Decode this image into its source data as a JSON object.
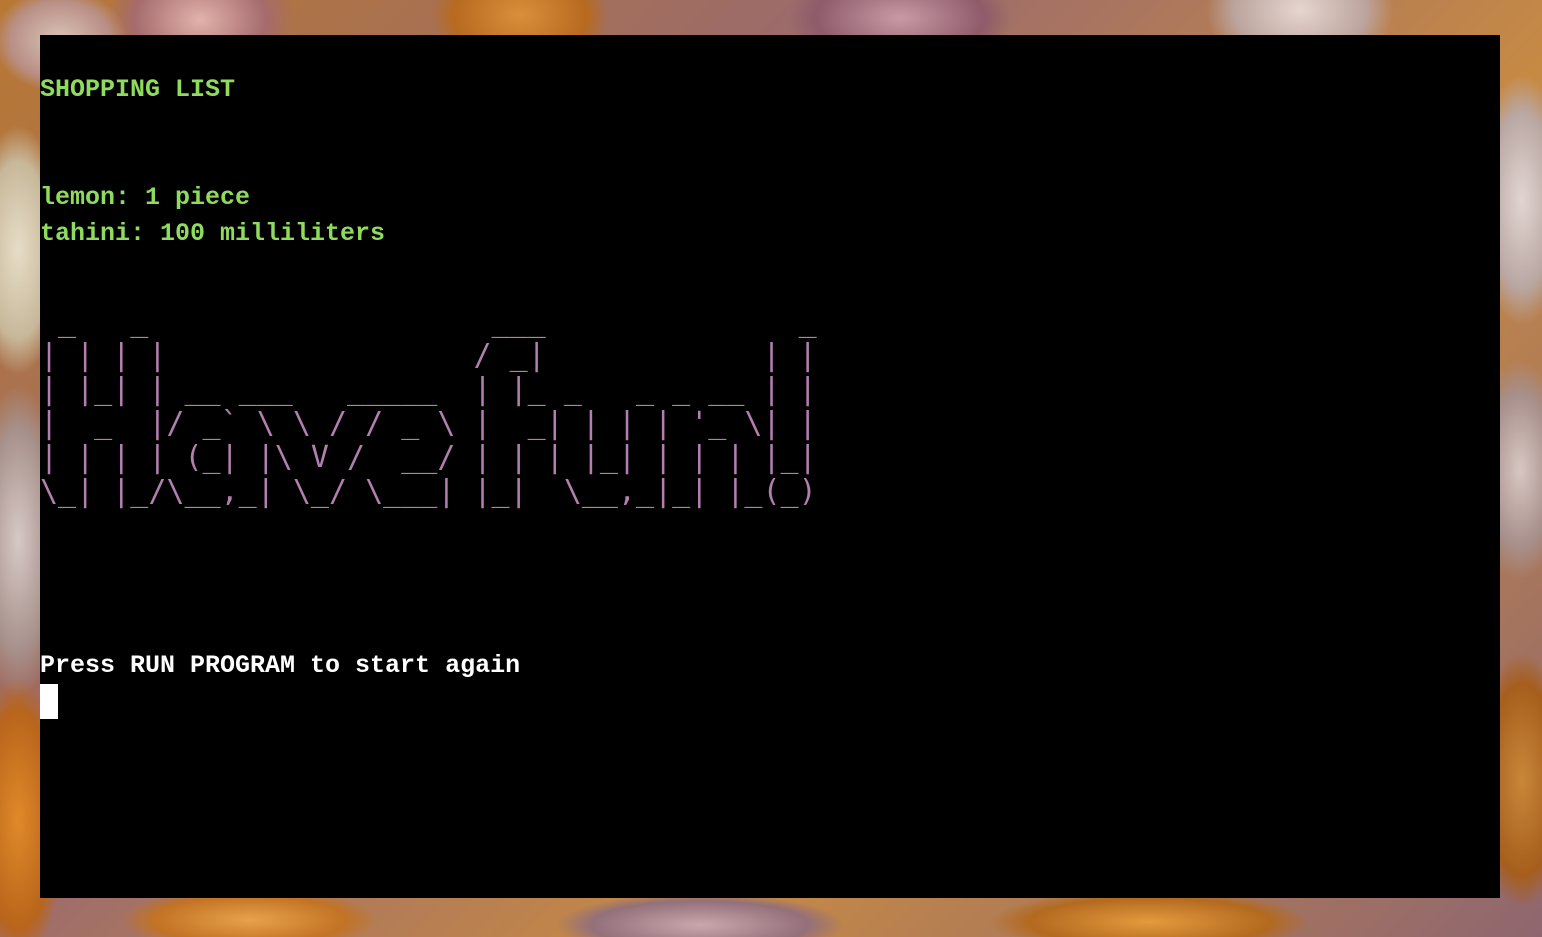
{
  "colors": {
    "list_text": "#8fdb5e",
    "banner_text": "#b27fb0",
    "prompt_text": "#ffffff",
    "cursor": "#ffffff",
    "terminal_background": "#000000"
  },
  "terminal": {
    "title": "SHOPPING LIST",
    "items": [
      "lemon: 1 piece",
      "tahini: 100 milliliters"
    ],
    "banner_ascii": " _   _                   ___              _ \n| | | |                 / _|            | |\n| |_| | __ ___   _____  | |_ _   _ _ __ | |\n|  _  |/ _` \\ \\ / / _ \\ |  _| | | | '_ \\| |\n| | | | (_| |\\ V /  __/ | | | |_| | | | |_|\n\\_| |_/\\__,_| \\_/ \\___| |_|  \\__,_|_| |_(_)",
    "prompt": "Press RUN PROGRAM to start again"
  }
}
